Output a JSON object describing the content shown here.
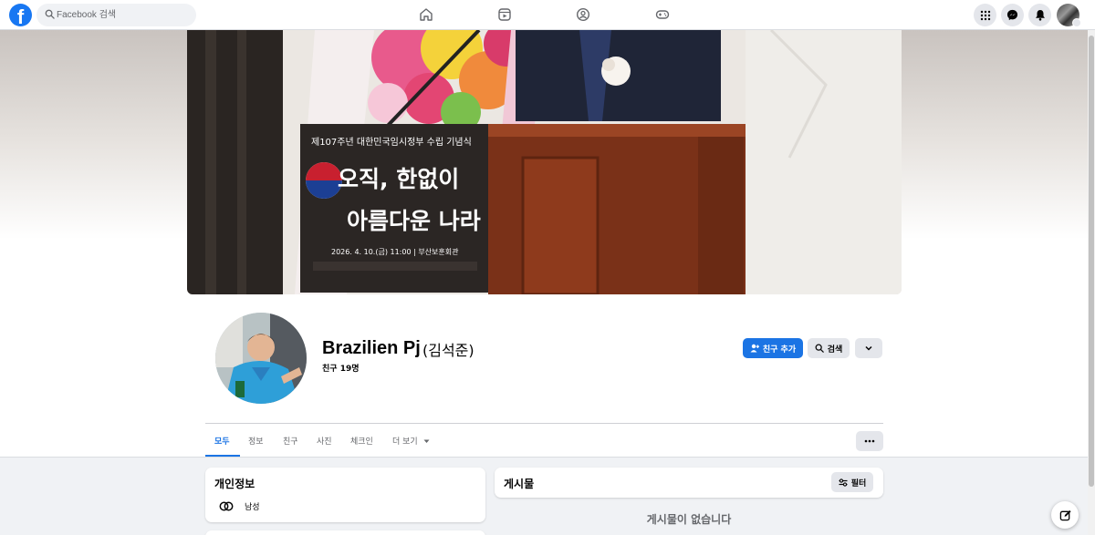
{
  "topbar": {
    "logo_letter": "f",
    "search_placeholder": "Facebook 검색"
  },
  "cover": {
    "banner_line1": "제107주년 대한민국임시정부 수립 기념식",
    "banner_line2": "오직, 한없이",
    "banner_line3": "아름다운 나라",
    "banner_line4": "2026. 4. 10.(금) 11:00 | 부산보훈회관"
  },
  "profile": {
    "name": "Brazilien Pj",
    "alt_name": "(김석준)",
    "friends": "친구 19명"
  },
  "actions": {
    "add_friend": "친구 추가",
    "search": "검색"
  },
  "tabs": [
    {
      "label": "모두"
    },
    {
      "label": "정보"
    },
    {
      "label": "친구"
    },
    {
      "label": "사진"
    },
    {
      "label": "체크인"
    },
    {
      "label": "더 보기"
    }
  ],
  "intro": {
    "title": "개인정보",
    "gender": "남성"
  },
  "posts": {
    "title": "게시물",
    "filter": "필터",
    "empty": "게시물이 없습니다"
  },
  "colors": {
    "accent": "#1b74e4",
    "logo": "#1877f2",
    "page_bg": "#f0f2f5"
  }
}
